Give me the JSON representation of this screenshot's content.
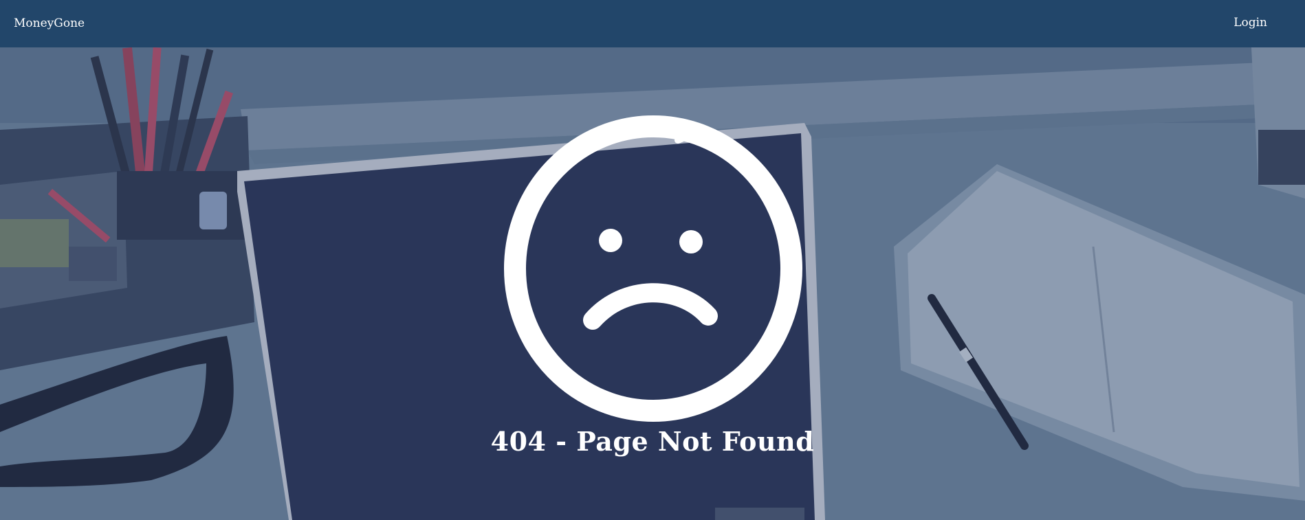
{
  "navbar": {
    "brand": "MoneyGone",
    "login_label": "Login"
  },
  "main": {
    "icon": "sad-face-icon",
    "title": "404 - Page Not Found"
  },
  "colors": {
    "navbar_bg": "#22466a",
    "overlay_tint": "#2a3b63",
    "text": "#ffffff"
  }
}
